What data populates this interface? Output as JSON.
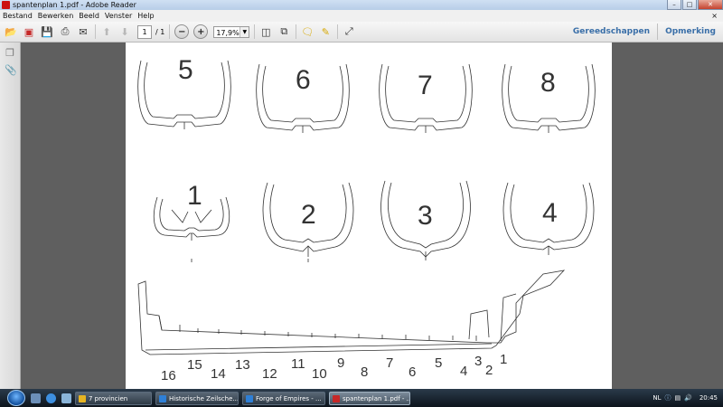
{
  "window": {
    "title": "spantenplan 1.pdf - Adobe Reader"
  },
  "menu": [
    "Bestand",
    "Bewerken",
    "Beeld",
    "Venster",
    "Help"
  ],
  "menu_close_glyph": "×",
  "toolbar": {
    "page_current": "1",
    "page_total": "/ 1",
    "zoom": "17,9%",
    "tools_label": "Gereedschappen",
    "comment_label": "Opmerking"
  },
  "document": {
    "frame_labels_top": [
      "5",
      "6",
      "7",
      "8"
    ],
    "frame_labels_mid": [
      "1",
      "2",
      "3",
      "4"
    ],
    "frame_numbers_bottom": [
      "16",
      "15",
      "14",
      "13",
      "12",
      "11",
      "10",
      "9",
      "8",
      "7",
      "6",
      "5",
      "4",
      "3",
      "2",
      "1"
    ]
  },
  "taskbar": {
    "tasks": [
      {
        "label": "7 provincien",
        "color": "#e6b422"
      },
      {
        "label": "Historische Zeilsche...",
        "color": "#2e7fd6"
      },
      {
        "label": "Forge of Empires - ...",
        "color": "#2e7fd6"
      },
      {
        "label": "spantenplan 1.pdf - ...",
        "color": "#c62828"
      }
    ],
    "language": "NL",
    "clock": "20:45"
  }
}
